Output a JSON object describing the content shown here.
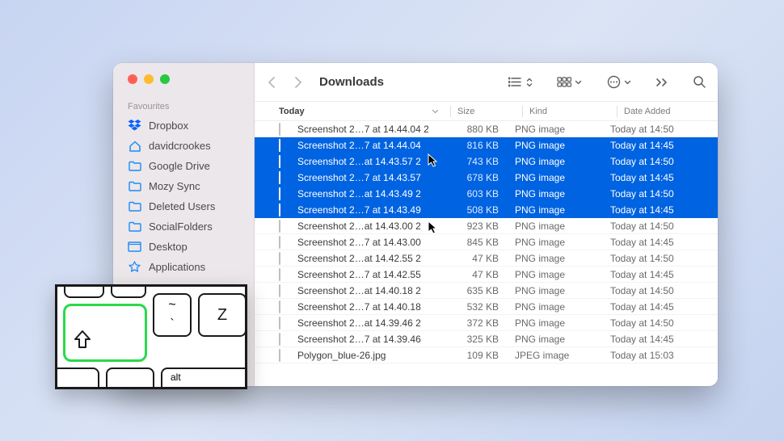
{
  "window_title": "Downloads",
  "sidebar": {
    "header": "Favourites",
    "items": [
      {
        "label": "Dropbox",
        "icon": "dropbox"
      },
      {
        "label": "davidcrookes",
        "icon": "home"
      },
      {
        "label": "Google Drive",
        "icon": "folder"
      },
      {
        "label": "Mozy Sync",
        "icon": "folder"
      },
      {
        "label": "Deleted Users",
        "icon": "folder"
      },
      {
        "label": "SocialFolders",
        "icon": "folder"
      },
      {
        "label": "Desktop",
        "icon": "desktop"
      },
      {
        "label": "Applications",
        "icon": "apps"
      }
    ]
  },
  "columns": {
    "group": "Today",
    "size": "Size",
    "kind": "Kind",
    "date": "Date Added"
  },
  "rows": [
    {
      "name": "Screenshot 2…7 at 14.44.04 2",
      "size": "880 KB",
      "kind": "PNG image",
      "date": "Today at 14:50",
      "sel": false
    },
    {
      "name": "Screenshot 2…7 at 14.44.04",
      "size": "816 KB",
      "kind": "PNG image",
      "date": "Today at 14:45",
      "sel": true
    },
    {
      "name": "Screenshot 2…at 14.43.57 2",
      "size": "743 KB",
      "kind": "PNG image",
      "date": "Today at 14:50",
      "sel": true
    },
    {
      "name": "Screenshot 2…7 at 14.43.57",
      "size": "678 KB",
      "kind": "PNG image",
      "date": "Today at 14:45",
      "sel": true
    },
    {
      "name": "Screenshot 2…at 14.43.49 2",
      "size": "603 KB",
      "kind": "PNG image",
      "date": "Today at 14:50",
      "sel": true
    },
    {
      "name": "Screenshot 2…7 at 14.43.49",
      "size": "508 KB",
      "kind": "PNG image",
      "date": "Today at 14:45",
      "sel": true
    },
    {
      "name": "Screenshot 2…at 14.43.00 2",
      "size": "923 KB",
      "kind": "PNG image",
      "date": "Today at 14:50",
      "sel": false
    },
    {
      "name": "Screenshot 2…7 at 14.43.00",
      "size": "845 KB",
      "kind": "PNG image",
      "date": "Today at 14:45",
      "sel": false
    },
    {
      "name": "Screenshot 2…at 14.42.55 2",
      "size": "47 KB",
      "kind": "PNG image",
      "date": "Today at 14:50",
      "sel": false
    },
    {
      "name": "Screenshot 2…7 at 14.42.55",
      "size": "47 KB",
      "kind": "PNG image",
      "date": "Today at 14:45",
      "sel": false
    },
    {
      "name": "Screenshot 2…at 14.40.18 2",
      "size": "635 KB",
      "kind": "PNG image",
      "date": "Today at 14:50",
      "sel": false
    },
    {
      "name": "Screenshot 2…7 at 14.40.18",
      "size": "532 KB",
      "kind": "PNG image",
      "date": "Today at 14:45",
      "sel": false
    },
    {
      "name": "Screenshot 2…at 14.39.46 2",
      "size": "372 KB",
      "kind": "PNG image",
      "date": "Today at 14:50",
      "sel": false
    },
    {
      "name": "Screenshot 2…7 at 14.39.46",
      "size": "325 KB",
      "kind": "PNG image",
      "date": "Today at 14:45",
      "sel": false
    },
    {
      "name": "Polygon_blue-26.jpg",
      "size": "109 KB",
      "kind": "JPEG image",
      "date": "Today at 15:03",
      "sel": false
    }
  ],
  "keyboard": {
    "shift_glyph": "⇧",
    "tilde": "~",
    "tilde2": "`",
    "z": "Z",
    "alt": "alt"
  }
}
